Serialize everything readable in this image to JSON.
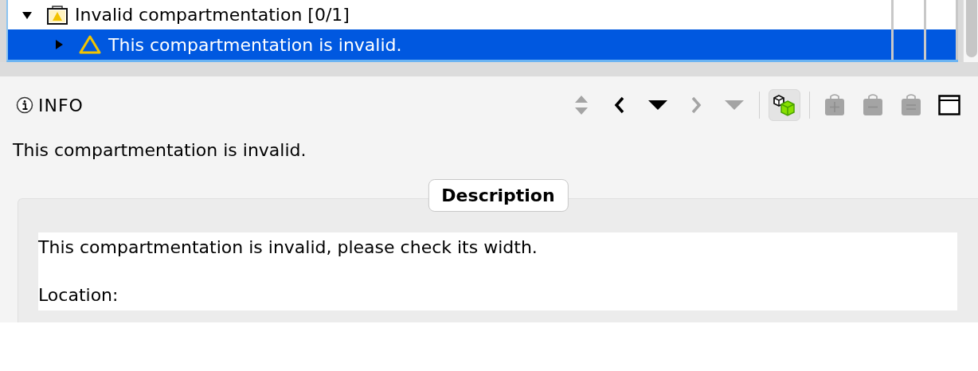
{
  "tree": {
    "rows": [
      {
        "label": "Invalid compartmentation [0/1]",
        "kind": "group",
        "expanded": true,
        "selected": false,
        "children": [
          {
            "label": "This compartmentation is invalid.",
            "kind": "warning",
            "expanded": false,
            "selected": true
          }
        ]
      }
    ]
  },
  "info": {
    "title": "INFO",
    "toolbar": [
      {
        "kind": "sort",
        "disabled": true
      },
      {
        "kind": "previous",
        "disabled": false
      },
      {
        "kind": "dropdown",
        "disabled": false
      },
      {
        "kind": "next",
        "disabled": true
      },
      {
        "kind": "dropdown",
        "disabled": true
      },
      {
        "kind": "separator"
      },
      {
        "kind": "cubes",
        "disabled": false,
        "selected": true
      },
      {
        "kind": "separator"
      },
      {
        "kind": "bag-add",
        "disabled": true
      },
      {
        "kind": "bag-remove",
        "disabled": true
      },
      {
        "kind": "bag-equal",
        "disabled": true
      },
      {
        "kind": "window",
        "disabled": false
      }
    ],
    "summary": "This compartmentation is invalid.",
    "description": {
      "legend": "Description",
      "paragraphs": [
        "This compartmentation is invalid, please check its width.",
        "Location:"
      ]
    }
  }
}
